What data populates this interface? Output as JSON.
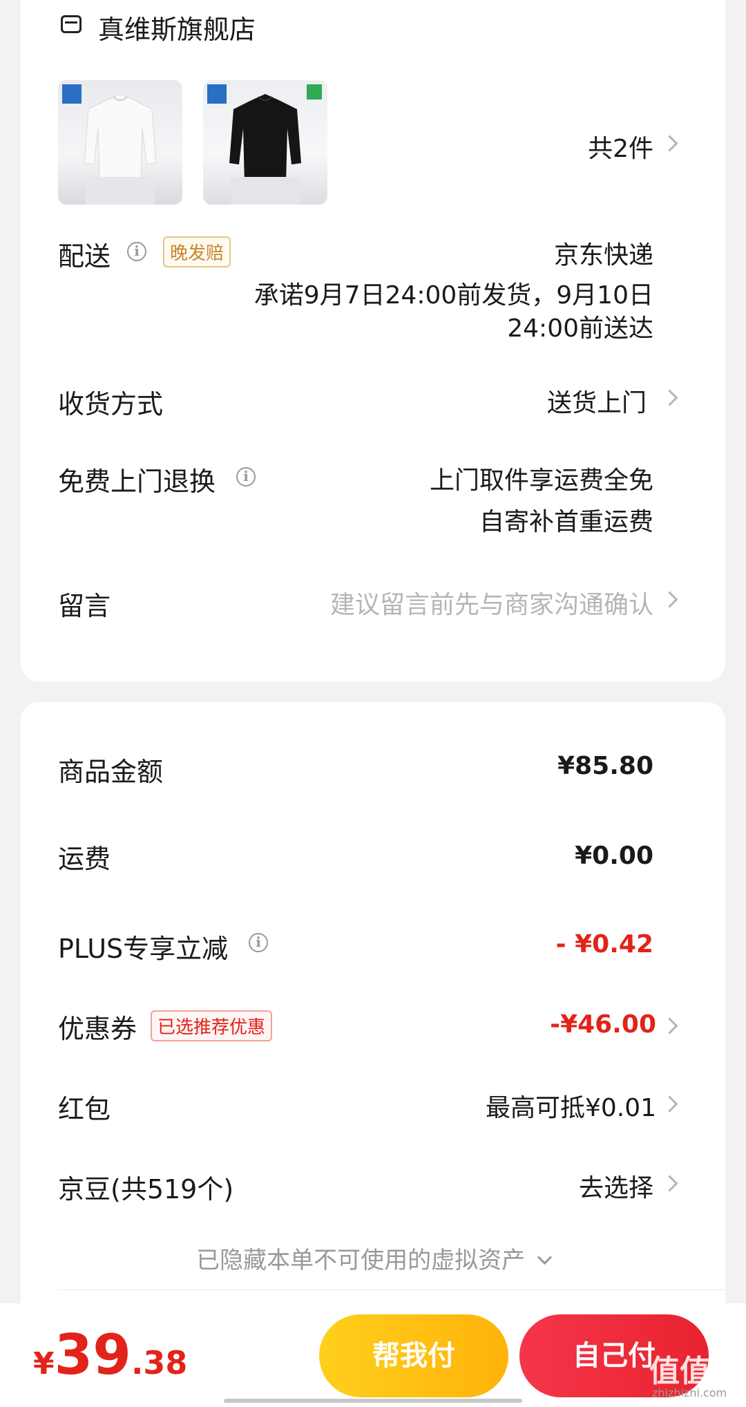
{
  "store": {
    "name": "真维斯旗舰店",
    "item_count": "共2件"
  },
  "delivery": {
    "label": "配送",
    "tag": "晚发赔",
    "carrier": "京东快递",
    "promise_line1": "承诺9月7日24:00前发货，9月10日",
    "promise_line2": "24:00前送达"
  },
  "receive": {
    "label": "收货方式",
    "value": "送货上门"
  },
  "return_service": {
    "label": "免费上门退换",
    "line1": "上门取件享运费全免",
    "line2": "自寄补首重运费"
  },
  "message": {
    "label": "留言",
    "placeholder": "建议留言前先与商家沟通确认"
  },
  "summary": {
    "goods_label": "商品金额",
    "goods_value": "¥85.80",
    "shipping_label": "运费",
    "shipping_value": "¥0.00",
    "plus_label": "PLUS专享立减",
    "plus_value": "- ¥0.42",
    "coupon_label": "优惠券",
    "coupon_tag": "已选推荐优惠",
    "coupon_value": "-¥46.00",
    "redpacket_label": "红包",
    "redpacket_value": "最高可抵¥0.01",
    "jingdou_label": "京豆(共519个)",
    "jingdou_value": "去选择",
    "hidden_assets": "已隐藏本单不可使用的虚拟资产"
  },
  "footer": {
    "currency": "¥",
    "price_int": "39",
    "price_dec": ".38",
    "help_pay": "帮我付",
    "self_pay": "自己付",
    "watermark": "值值值",
    "watermark_url": "zhizhizhi.com"
  },
  "colors": {
    "accent_red": "#e2231a",
    "accent_orange": "#c8862b",
    "help_btn": "#ffc20e",
    "self_btn": "#f0303f"
  }
}
